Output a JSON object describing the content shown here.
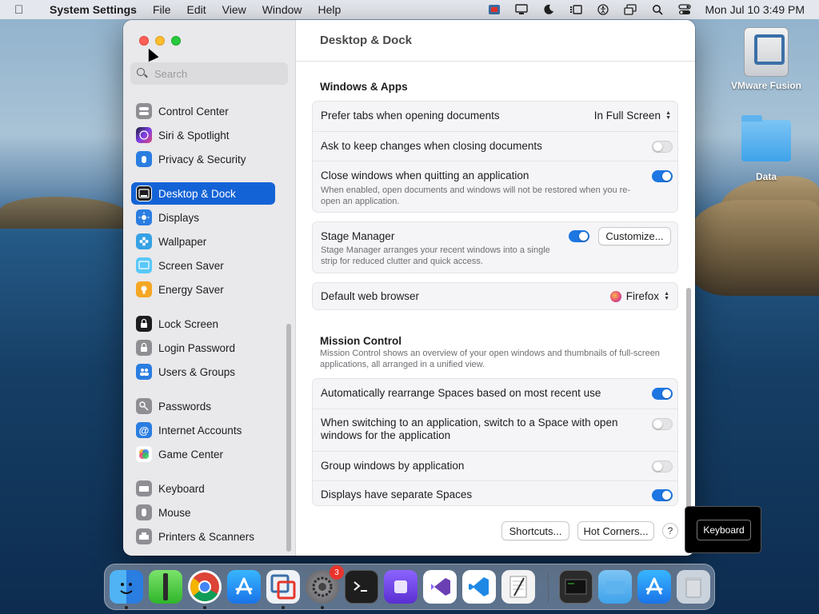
{
  "menubar": {
    "app_name": "System Settings",
    "items": [
      "File",
      "Edit",
      "View",
      "Window",
      "Help"
    ],
    "clock": "Mon Jul 10  3:49 PM"
  },
  "desktop": {
    "icons": [
      {
        "label": "VMware Fusion"
      },
      {
        "label": "Data"
      }
    ]
  },
  "window": {
    "title": "Desktop & Dock",
    "search_placeholder": "Search",
    "sidebar": {
      "items": [
        {
          "label": "Control Center",
          "icon": "control-center-icon",
          "color": "#8e8e93"
        },
        {
          "label": "Siri & Spotlight",
          "icon": "siri-icon",
          "color": "#7b3fe4"
        },
        {
          "label": "Privacy & Security",
          "icon": "hand-icon",
          "color": "#2a7de1"
        },
        {
          "label": "Desktop & Dock",
          "icon": "dock-icon",
          "color": "#1d1d1f",
          "active": true
        },
        {
          "label": "Displays",
          "icon": "sun-icon",
          "color": "#2a7de1"
        },
        {
          "label": "Wallpaper",
          "icon": "flower-icon",
          "color": "#36a2e6"
        },
        {
          "label": "Screen Saver",
          "icon": "screen-saver-icon",
          "color": "#5ac8fa"
        },
        {
          "label": "Energy Saver",
          "icon": "bulb-icon",
          "color": "#f5a623"
        },
        {
          "label": "Lock Screen",
          "icon": "lock-icon",
          "color": "#1d1d1f"
        },
        {
          "label": "Login Password",
          "icon": "lock-icon",
          "color": "#8e8e93"
        },
        {
          "label": "Users & Groups",
          "icon": "users-icon",
          "color": "#2a7de1"
        },
        {
          "label": "Passwords",
          "icon": "key-icon",
          "color": "#8e8e93"
        },
        {
          "label": "Internet Accounts",
          "icon": "at-icon",
          "color": "#2a7de1"
        },
        {
          "label": "Game Center",
          "icon": "game-center-icon",
          "color": "#ffffff"
        },
        {
          "label": "Keyboard",
          "icon": "keyboard-icon",
          "color": "#8e8e93"
        },
        {
          "label": "Mouse",
          "icon": "mouse-icon",
          "color": "#8e8e93"
        },
        {
          "label": "Printers & Scanners",
          "icon": "printer-icon",
          "color": "#8e8e93"
        }
      ]
    },
    "windows_apps": {
      "title": "Windows & Apps",
      "prefer_tabs": {
        "label": "Prefer tabs when opening documents",
        "value": "In Full Screen"
      },
      "ask_keep": {
        "label": "Ask to keep changes when closing documents",
        "on": false
      },
      "close_windows": {
        "label": "Close windows when quitting an application",
        "sub": "When enabled, open documents and windows will not be restored when you re-open an application.",
        "on": true
      },
      "stage_manager": {
        "label": "Stage Manager",
        "sub": "Stage Manager arranges your recent windows into a single strip for reduced clutter and quick access.",
        "on": true,
        "button": "Customize..."
      },
      "default_browser": {
        "label": "Default web browser",
        "value": "Firefox"
      }
    },
    "mission_control": {
      "title": "Mission Control",
      "desc": "Mission Control shows an overview of your open windows and thumbnails of full-screen applications, all arranged in a unified view.",
      "rows": [
        {
          "label": "Automatically rearrange Spaces based on most recent use",
          "on": true
        },
        {
          "label": "When switching to an application, switch to a Space with open windows for the application",
          "on": false
        },
        {
          "label": "Group windows by application",
          "on": false
        },
        {
          "label": "Displays have separate Spaces",
          "on": true
        }
      ]
    },
    "footer": {
      "shortcuts": "Shortcuts...",
      "hot_corners": "Hot Corners...",
      "help": "?"
    }
  },
  "tooltip": {
    "label": "Keyboard"
  },
  "dock": {
    "badge_count": "3"
  }
}
